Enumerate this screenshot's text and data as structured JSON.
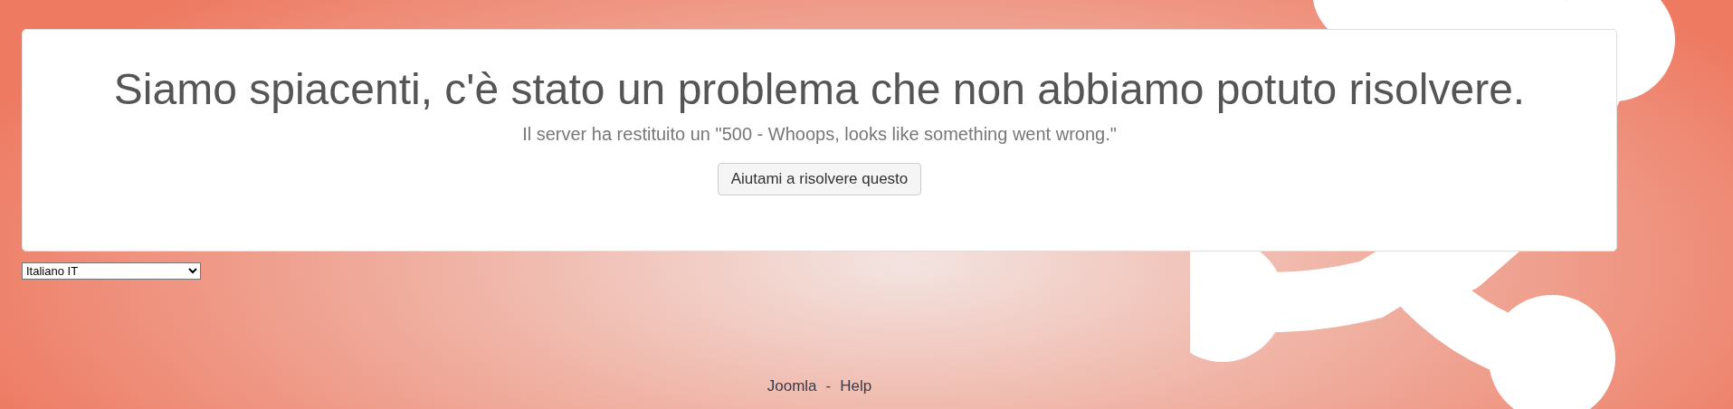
{
  "error": {
    "title": "Siamo spiacenti, c'è stato un problema che non abbiamo potuto risolvere.",
    "message": "Il server ha restituito un \"500 - Whoops, looks like something went wrong.\"",
    "button": "Aiutami a risolvere questo"
  },
  "language_select": {
    "value": "Italiano IT"
  },
  "footer": {
    "links": [
      "Joomla",
      "Help"
    ],
    "separator": "-"
  }
}
